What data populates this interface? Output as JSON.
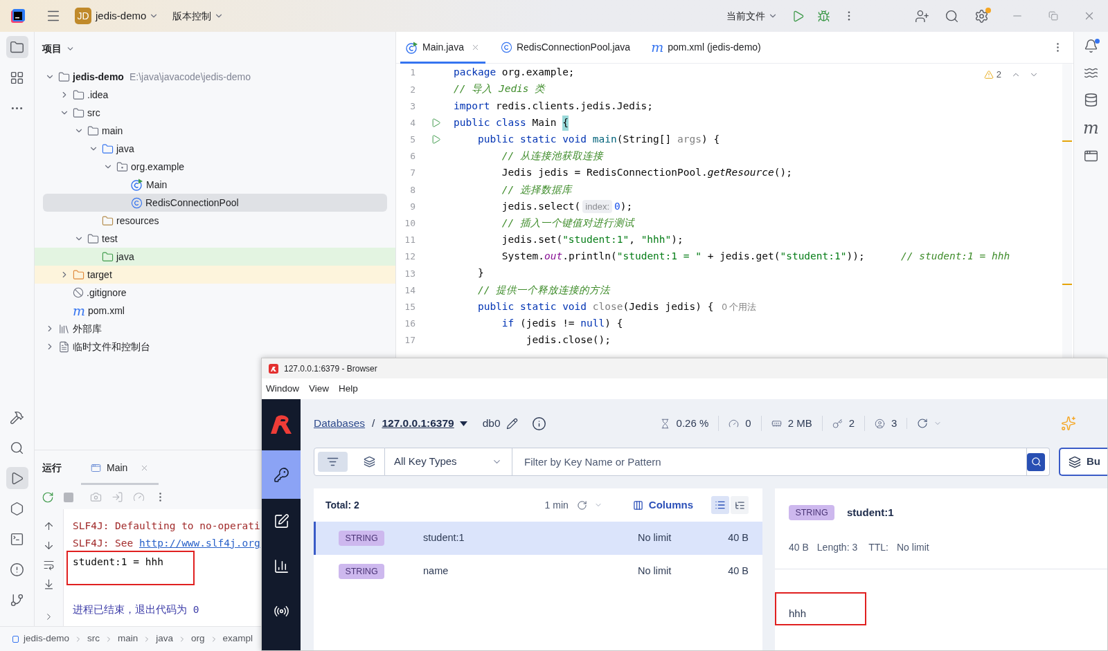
{
  "ide": {
    "project_badge": "JD",
    "project_name": "jedis-demo",
    "vcs_menu": "版本控制",
    "run_config": "当前文件",
    "left_tools": [
      {
        "kind": "project",
        "selected": true
      },
      {
        "kind": "structure",
        "selected": false
      },
      {
        "kind": "more",
        "selected": false
      }
    ],
    "bottom_tools": [
      {
        "kind": "build",
        "selected": false
      },
      {
        "kind": "search",
        "selected": false
      },
      {
        "kind": "run",
        "selected": true
      },
      {
        "kind": "services",
        "selected": false
      },
      {
        "kind": "terminal",
        "selected": false
      },
      {
        "kind": "problems",
        "selected": false
      },
      {
        "kind": "git",
        "selected": false
      }
    ],
    "project_panel": {
      "title": "项目",
      "tree": [
        {
          "label": "jedis-demo",
          "path": "E:\\java\\javacode\\jedis-demo",
          "kind": "module",
          "expanded": true,
          "selected": false,
          "children": [
            {
              "label": ".idea",
              "kind": "folder",
              "expanded": false,
              "selected": false
            },
            {
              "label": "src",
              "kind": "folder",
              "expanded": true,
              "selected": false,
              "children": [
                {
                  "label": "main",
                  "kind": "folder",
                  "expanded": true,
                  "selected": false,
                  "children": [
                    {
                      "label": "java",
                      "kind": "source-folder",
                      "expanded": true,
                      "selected": false,
                      "children": [
                        {
                          "label": "org.example",
                          "kind": "package",
                          "expanded": true,
                          "selected": false,
                          "children": [
                            {
                              "label": "Main",
                              "kind": "class-main",
                              "selected": false
                            },
                            {
                              "label": "RedisConnectionPool",
                              "kind": "class",
                              "selected": true
                            }
                          ]
                        }
                      ]
                    },
                    {
                      "label": "resources",
                      "kind": "resources",
                      "selected": false
                    }
                  ]
                },
                {
                  "label": "test",
                  "kind": "folder",
                  "expanded": true,
                  "selected": false,
                  "children": [
                    {
                      "label": "java",
                      "kind": "test-folder",
                      "selected": false
                    }
                  ]
                }
              ]
            },
            {
              "label": "target",
              "kind": "excluded-folder",
              "expanded": false,
              "selected": false
            },
            {
              "label": ".gitignore",
              "kind": "ignore",
              "selected": false
            },
            {
              "label": "pom.xml",
              "kind": "maven",
              "glyph": "m",
              "selected": false
            }
          ]
        },
        {
          "label": "外部库",
          "kind": "library",
          "expanded": false,
          "selected": false
        },
        {
          "label": "临时文件和控制台",
          "kind": "scratch",
          "expanded": false,
          "selected": false
        }
      ]
    },
    "editor": {
      "tabs": [
        {
          "label": "Main.java",
          "kind": "class-main",
          "selected": true
        },
        {
          "label": "RedisConnectionPool.java",
          "kind": "class",
          "selected": false
        },
        {
          "label": "pom.xml (jedis-demo)",
          "kind": "maven",
          "glyph": "m",
          "selected": false
        }
      ],
      "warning_count": "2",
      "lines": [
        {
          "number": "1",
          "run": false,
          "tokens": [
            {
              "text": "package ",
              "kind": "kw"
            },
            {
              "text": "org.example;",
              "kind": "plain"
            }
          ]
        },
        {
          "number": "2",
          "run": false,
          "tokens": [
            {
              "text": "// 导入 Jedis 类",
              "kind": "comment"
            }
          ]
        },
        {
          "number": "3",
          "run": false,
          "tokens": [
            {
              "text": "import ",
              "kind": "kw"
            },
            {
              "text": "redis.clients.jedis.Jedis;",
              "kind": "plain"
            }
          ]
        },
        {
          "number": "4",
          "run": true,
          "tokens": [
            {
              "text": "public class ",
              "kind": "kw"
            },
            {
              "text": "Main ",
              "kind": "plain"
            },
            {
              "text": "{",
              "kind": "brace"
            }
          ]
        },
        {
          "number": "5",
          "run": true,
          "tokens": [
            {
              "text": "    public static void ",
              "kind": "kw"
            },
            {
              "text": "main",
              "kind": "decl"
            },
            {
              "text": "(String[] ",
              "kind": "plain"
            },
            {
              "text": "args",
              "kind": "param"
            },
            {
              "text": ") {",
              "kind": "plain"
            }
          ]
        },
        {
          "number": "6",
          "run": false,
          "tokens": [
            {
              "text": "        // 从连接池获取连接",
              "kind": "comment"
            }
          ]
        },
        {
          "number": "7",
          "run": false,
          "tokens": [
            {
              "text": "        Jedis jedis = RedisConnectionPool.",
              "kind": "plain"
            },
            {
              "text": "getResource",
              "kind": "static"
            },
            {
              "text": "();",
              "kind": "plain"
            }
          ]
        },
        {
          "number": "8",
          "run": false,
          "tokens": [
            {
              "text": "        // 选择数据库",
              "kind": "comment"
            }
          ]
        },
        {
          "number": "9",
          "run": false,
          "tokens": [
            {
              "text": "        jedis.select(",
              "kind": "plain"
            },
            {
              "text": "index:",
              "kind": "hint"
            },
            {
              "text": "0",
              "kind": "num"
            },
            {
              "text": ");",
              "kind": "plain"
            }
          ]
        },
        {
          "number": "10",
          "run": false,
          "tokens": [
            {
              "text": "        // 插入一个键值对进行测试",
              "kind": "comment"
            }
          ]
        },
        {
          "number": "11",
          "run": false,
          "tokens": [
            {
              "text": "        jedis.set(",
              "kind": "plain"
            },
            {
              "text": "\"student:1\"",
              "kind": "str"
            },
            {
              "text": ", ",
              "kind": "plain"
            },
            {
              "text": "\"hhh\"",
              "kind": "str"
            },
            {
              "text": ");",
              "kind": "plain"
            }
          ]
        },
        {
          "number": "12",
          "run": false,
          "tokens": [
            {
              "text": "        System.",
              "kind": "plain"
            },
            {
              "text": "out",
              "kind": "field"
            },
            {
              "text": ".println(",
              "kind": "plain"
            },
            {
              "text": "\"student:1 = \"",
              "kind": "str"
            },
            {
              "text": " + jedis.get(",
              "kind": "plain"
            },
            {
              "text": "\"student:1\"",
              "kind": "str"
            },
            {
              "text": "));",
              "kind": "plain"
            },
            {
              "text": "      // student:1 = hhh",
              "kind": "comment"
            }
          ]
        },
        {
          "number": "13",
          "run": false,
          "tokens": [
            {
              "text": "    }",
              "kind": "plain"
            }
          ]
        },
        {
          "number": "14",
          "run": false,
          "tokens": [
            {
              "text": "    // 提供一个释放连接的方法",
              "kind": "comment"
            }
          ]
        },
        {
          "number": "15",
          "run": false,
          "tokens": [
            {
              "text": "    public static void ",
              "kind": "kw"
            },
            {
              "text": "close",
              "kind": "unused"
            },
            {
              "text": "(Jedis jedis) {",
              "kind": "plain"
            },
            {
              "text": "0 个用法",
              "kind": "usage"
            }
          ]
        },
        {
          "number": "16",
          "run": false,
          "tokens": [
            {
              "text": "        if ",
              "kind": "kw"
            },
            {
              "text": "(jedis != ",
              "kind": "plain"
            },
            {
              "text": "null",
              "kind": "kw"
            },
            {
              "text": ") {",
              "kind": "plain"
            }
          ]
        },
        {
          "number": "17",
          "run": false,
          "tokens": [
            {
              "text": "            jedis.close();",
              "kind": "plain"
            }
          ]
        }
      ]
    },
    "maven_tool": {
      "glyph": "m"
    },
    "run_panel": {
      "title": "运行",
      "tab": "Main",
      "console": [
        {
          "kind": "error",
          "text": "SLF4J: Defaulting to no-operati",
          "boxed": false
        },
        {
          "kind": "error",
          "text": "SLF4J: See ",
          "link": "http://www.slf4j.org",
          "boxed": false
        },
        {
          "kind": "output",
          "text": "student:1 = hhh",
          "boxed": true
        },
        {
          "kind": "exit",
          "text": "进程已结束，退出代码为 0",
          "boxed": false
        }
      ]
    },
    "breadcrumb": [
      "jedis-demo",
      "src",
      "main",
      "java",
      "org",
      "exampl"
    ]
  },
  "browser": {
    "title": "127.0.0.1:6379 - Browser",
    "menu": [
      "Window",
      "View",
      "Help"
    ],
    "nav": [
      {
        "kind": "browser",
        "selected": true
      },
      {
        "kind": "workbench",
        "selected": false
      },
      {
        "kind": "analytics",
        "selected": false
      },
      {
        "kind": "pubsub",
        "selected": false
      }
    ],
    "breadcrumb": {
      "root": "Databases",
      "separator": "/",
      "database": "127.0.0.1:6379"
    },
    "db": "db0",
    "stats": [
      {
        "kind": "cpu",
        "value": "0.26 %"
      },
      {
        "kind": "ops",
        "value": "0"
      },
      {
        "kind": "memory",
        "value": "2 MB"
      },
      {
        "kind": "keys",
        "value": "2"
      },
      {
        "kind": "clients",
        "value": "3"
      }
    ],
    "filter": {
      "modes": [
        {
          "kind": "filter",
          "selected": true
        },
        {
          "kind": "search",
          "selected": false
        }
      ],
      "key_type": "All Key Types",
      "placeholder": "Filter by Key Name or Pattern",
      "bulk_button": "Bu"
    },
    "list": {
      "total": "Total: 2",
      "refresh": "1 min",
      "columns": "Columns",
      "views": [
        {
          "kind": "list",
          "selected": true
        },
        {
          "kind": "tree",
          "selected": false
        }
      ],
      "rows": [
        {
          "type": "STRING",
          "key": "student:1",
          "ttl": "No limit",
          "size": "40 B",
          "selected": true
        },
        {
          "type": "STRING",
          "key": "name",
          "ttl": "No limit",
          "size": "40 B",
          "selected": false
        }
      ]
    },
    "detail": {
      "type": "STRING",
      "key": "student:1",
      "size": "40 B",
      "length": "Length: 3",
      "ttl_label": "TTL:",
      "ttl": "No limit",
      "value": "hhh",
      "boxed": true
    }
  }
}
